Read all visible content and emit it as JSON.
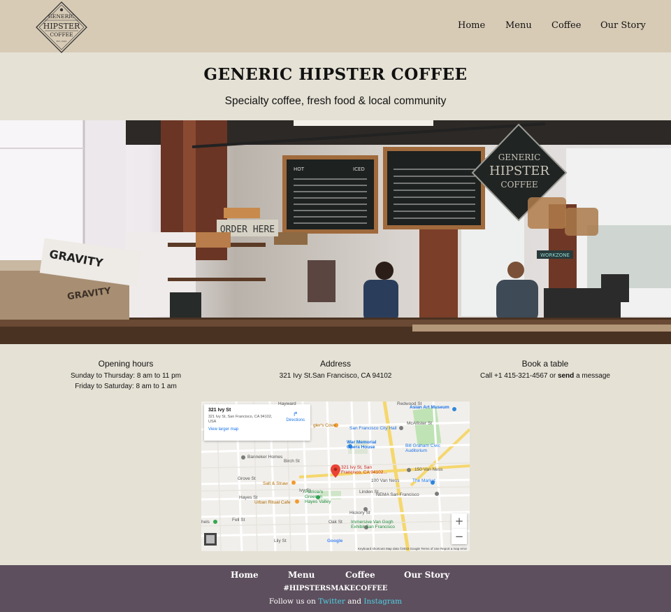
{
  "brand": {
    "logo_lines": [
      "GENERIC",
      "HIPSTER",
      "COFFEE",
      "EST. 2022"
    ]
  },
  "nav": [
    "Home",
    "Menu",
    "Coffee",
    "Our Story"
  ],
  "hero": {
    "title": "GENERIC HIPSTER COFFEE",
    "subtitle": "Specialty coffee, fresh food & local community"
  },
  "photo_signs": {
    "menu_left_header": [
      "HOT",
      "ICED"
    ],
    "order_here": "ORDER HERE",
    "hanging_sign": [
      "GENERIC",
      "HIPSTER",
      "COFFEE"
    ],
    "crate": "GRAVITY",
    "work_zone": "WORKZONE"
  },
  "info": {
    "hours": {
      "heading": "Opening hours",
      "line1": "Sunday to Thursday: 8 am to 11 pm",
      "line2": "Friday to Saturday: 8 am to 1 am"
    },
    "address": {
      "heading": "Address",
      "line1": "321 Ivy St.San Francisco, CA 94102"
    },
    "book": {
      "heading": "Book a table",
      "prefix": "Call +1 415-321-4567 or",
      "send": "send",
      "suffix": "a message"
    }
  },
  "map": {
    "place_name": "321 Ivy St",
    "place_address": "321 Ivy St, San Francisco, CA 94102, USA",
    "larger_map": "View larger map",
    "directions": "Directions",
    "pin_label_1": "321 Ivy St, San",
    "pin_label_2": "Francisco, CA 94102...",
    "labels": {
      "hayward": "Hayward",
      "asian_art": "Asian Art Museum",
      "city_hall": "San Francisco City Hall",
      "war_memorial": "War Memorial Opera House",
      "bill_graham": "Bill Graham Civic Auditorium",
      "banneker": "Banneker Homes",
      "van_ness_150": "150 Van Ness",
      "van_ness_100": "100 Van Ness",
      "market": "The Market",
      "salt_straw": "Salt & Straw",
      "patricias": "Patricia's Green in Hayes Valley",
      "urban_ritual": "Urban Ritual Cafe",
      "nema": "NEMA San Francisco",
      "van_gogh": "Immersive Van Gogh Exhibit San Francisco",
      "gler": "gler's Cove",
      "hayes_st": "Hayes St",
      "grove_st": "Grove St",
      "fell_st": "Fell St",
      "oak_st": "Oak St",
      "hickory": "Hickory St",
      "birch": "Birch St",
      "linden": "Linden St",
      "ivy": "Ivy St",
      "lily": "Lily St",
      "mcallister": "McAllister St",
      "redwood": "Redwood St",
      "hels": "hels"
    },
    "zoom_in": "+",
    "zoom_out": "−",
    "footer": "Keyboard shortcuts   Map data ©2022 Google   Terms of Use   Report a map error",
    "google": "Google"
  },
  "footer": {
    "nav": [
      "Home",
      "Menu",
      "Coffee",
      "Our Story"
    ],
    "hashtag": "#HIPSTERSMAKECOFFEE",
    "follow_prefix": "Follow us on",
    "twitter": "Twitter",
    "and": "and",
    "instagram": "Instagram"
  },
  "colors": {
    "header_bg": "#d8cbb6",
    "page_bg": "#e5e1d5",
    "footer_bg": "#5d4f5d",
    "link_cyan": "#4fd0e6"
  }
}
